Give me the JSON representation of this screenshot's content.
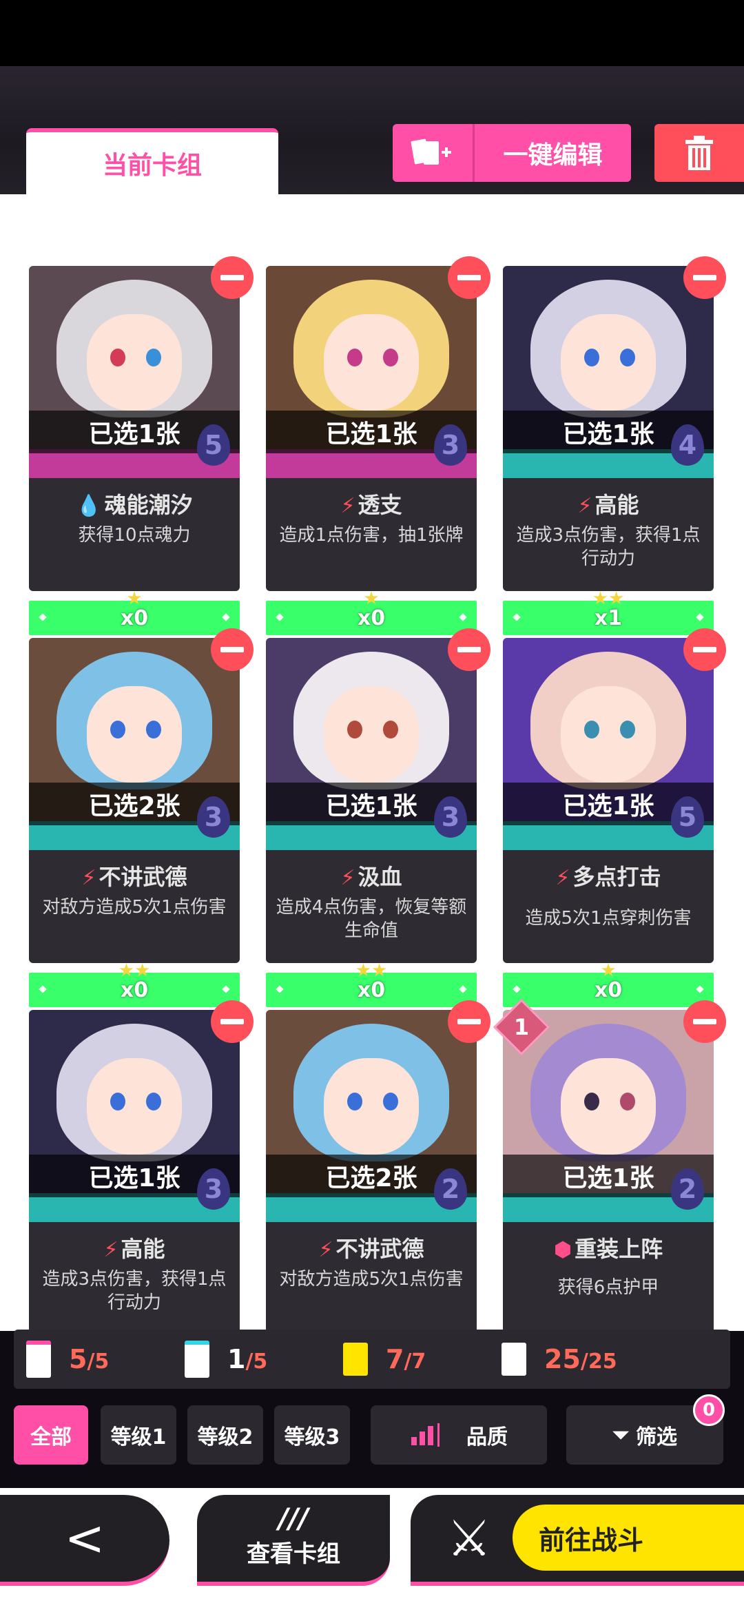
{
  "header": {
    "tab_current": "当前卡组",
    "edit_label": "一键编辑"
  },
  "top_counts": [
    "x1",
    "x0",
    "x0"
  ],
  "cards": [
    {
      "selected": "已选1张",
      "cost": "5",
      "title": "魂能潮汐",
      "icon": "drop-icon",
      "desc": "获得10点魂力",
      "stars": "★",
      "count": "x0"
    },
    {
      "selected": "已选1张",
      "cost": "3",
      "title": "透支",
      "icon": "lightning-icon",
      "desc": "造成1点伤害，抽1张牌",
      "stars": "★",
      "count": "x0"
    },
    {
      "selected": "已选1张",
      "cost": "4",
      "title": "高能",
      "icon": "lightning-icon",
      "desc": "造成3点伤害，获得1点行动力",
      "stars": "★★",
      "count": "x1"
    },
    {
      "selected": "已选2张",
      "cost": "3",
      "title": "不讲武德",
      "icon": "lightning-icon",
      "desc": "对敌方造成5次1点伤害",
      "stars": "★★",
      "count": "x0"
    },
    {
      "selected": "已选1张",
      "cost": "3",
      "title": "汲血",
      "icon": "lightning-icon",
      "desc": "造成4点伤害，恢复等额生命值",
      "stars": "★★",
      "count": "x0"
    },
    {
      "selected": "已选1张",
      "cost": "5",
      "title": "多点打击",
      "icon": "lightning-icon",
      "desc": "造成5次1点穿刺伤害",
      "stars": "★",
      "count": "x0"
    },
    {
      "selected": "已选1张",
      "cost": "3",
      "title": "高能",
      "icon": "lightning-icon",
      "desc": "造成3点伤害，获得1点行动力",
      "stars": "",
      "count": ""
    },
    {
      "selected": "已选2张",
      "cost": "2",
      "title": "不讲武德",
      "icon": "lightning-icon",
      "desc": "对敌方造成5次1点伤害",
      "stars": "",
      "count": ""
    },
    {
      "selected": "已选1张",
      "cost": "2",
      "title": "重装上阵",
      "icon": "shield-icon",
      "desc": "获得6点护甲",
      "stars": "",
      "count": "",
      "rank": "1"
    }
  ],
  "stats": [
    {
      "value": "5",
      "max": "/5",
      "color": "#ff6a5a"
    },
    {
      "value": "1",
      "max": "/5",
      "color": "#ffffff"
    },
    {
      "value": "7",
      "max": "/7",
      "color": "#ff6a5a"
    },
    {
      "value": "25",
      "max": "/25",
      "color": "#ff6a5a"
    }
  ],
  "filters": {
    "all": "全部",
    "level1": "等级1",
    "level2": "等级2",
    "level3": "等级3",
    "quality": "品质",
    "filter": "筛选",
    "filter_badge": "0"
  },
  "bottom": {
    "back_icon": "<",
    "view_icon": "///",
    "view_label": "查看卡组",
    "fight_label": "前往战斗"
  }
}
